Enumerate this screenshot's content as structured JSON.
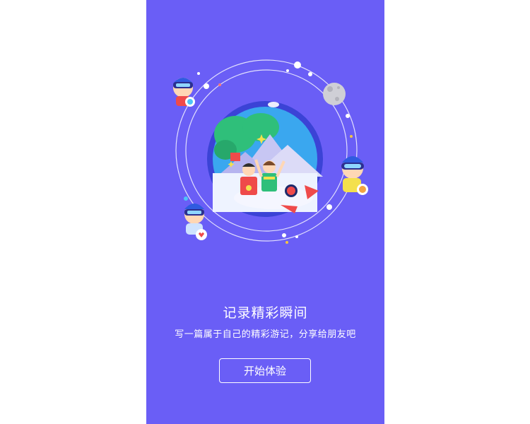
{
  "onboarding": {
    "title": "记录精彩瞬间",
    "subtitle": "写一篇属于自己的精彩游记，分享给朋友吧",
    "start_button_label": "开始体验"
  },
  "illustration": {
    "icons": [
      "globe-illustration",
      "rocket-icon",
      "moon-icon",
      "avatar-chat-icon",
      "avatar-like-icon",
      "avatar-heart-icon"
    ]
  },
  "colors": {
    "background": "#6a5ef6",
    "text": "#ffffff",
    "globe_rim": "#3b43d6",
    "sky": "#3aa7ef",
    "tree": "#2fbf7a",
    "rocket": "#ef4a4a"
  }
}
